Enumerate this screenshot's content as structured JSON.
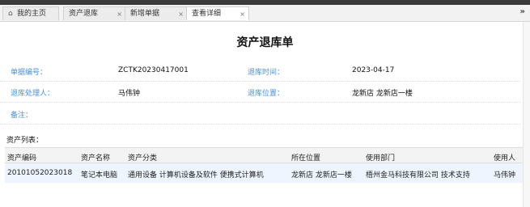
{
  "tabs": [
    {
      "label": "我的主页",
      "icon": "home-icon",
      "closable": false
    },
    {
      "label": "资产退库",
      "closable": true
    },
    {
      "label": "新增单据",
      "closable": true
    },
    {
      "label": "查看详细",
      "closable": true,
      "active": true
    }
  ],
  "tab_close_glyph": "×",
  "overflow_glyph": "»",
  "page_title": "资产退库单",
  "form": {
    "doc_no_label": "单据编号：",
    "doc_no_value": "ZCTK20230417001",
    "return_time_label": "退库时间：",
    "return_time_value": "2023-04-17",
    "handler_label": "退库处理人：",
    "handler_value": "马伟钟",
    "location_label": "退库位置：",
    "location_value": "龙新店 龙新店一楼",
    "remark_label": "备注："
  },
  "asset_list": {
    "title": "资产列表：",
    "columns": [
      "资产编码",
      "资产名称",
      "资产分类",
      "所在位置",
      "使用部门",
      "使用人"
    ],
    "rows": [
      [
        "20101052023018",
        "笔记本电脑",
        "通用设备 计算机设备及软件 便携式计算机",
        "龙新店 龙新店一楼",
        "梧州金马科技有限公司 技术支持",
        "马伟钟"
      ]
    ]
  }
}
